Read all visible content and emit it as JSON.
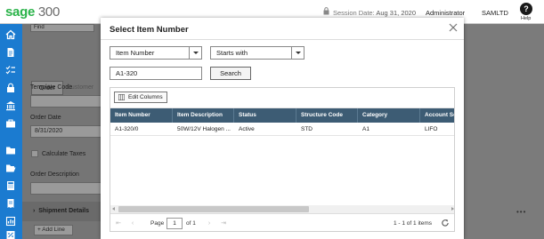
{
  "header": {
    "logo_brand": "sage",
    "logo_version": "300",
    "session_label": "Session Date:",
    "session_date": "Aug 31, 2020",
    "user": "Administrator",
    "company": "SAMLTD",
    "help_label": "Help"
  },
  "nav_icons": [
    "home-icon",
    "document-icon",
    "list-check-icon",
    "lock-icon",
    "bank-icon",
    "briefcase-icon",
    "folder-icon",
    "folder-open-icon",
    "calculator-icon",
    "receipt-icon",
    "chart-icon",
    "percent-icon"
  ],
  "background_form": {
    "tab_order": "Order",
    "tab_customer": "Customer",
    "template_code_label": "Template Code",
    "order_date_label": "Order Date",
    "order_date_value": "8/31/2020",
    "calculate_taxes_label": "Calculate Taxes",
    "order_description_label": "Order Description",
    "shipment_details_label": "Shipment Details",
    "add_line_label": "Add Line",
    "top_select_value": "Find"
  },
  "dialog": {
    "title": "Select Item Number",
    "filter_field": "Item Number",
    "filter_operator": "Starts with",
    "search_value": "A1-320",
    "search_button": "Search",
    "edit_columns_button": "Edit Columns",
    "columns": [
      "Item Number",
      "Item Description",
      "Status",
      "Structure Code",
      "Category",
      "Account Se"
    ],
    "rows": [
      [
        "A1-320/0",
        "50W/12V Halogen ...",
        "Active",
        "STD",
        "A1",
        "LIFO"
      ]
    ],
    "pager": {
      "page_label": "Page",
      "page_value": "1",
      "of_label": "of 1",
      "count_label": "1 - 1 of 1 items"
    }
  },
  "colors": {
    "nav_blue": "#1b7bd0",
    "grid_header": "#3d5c74",
    "brand_green": "#2bb34a"
  }
}
